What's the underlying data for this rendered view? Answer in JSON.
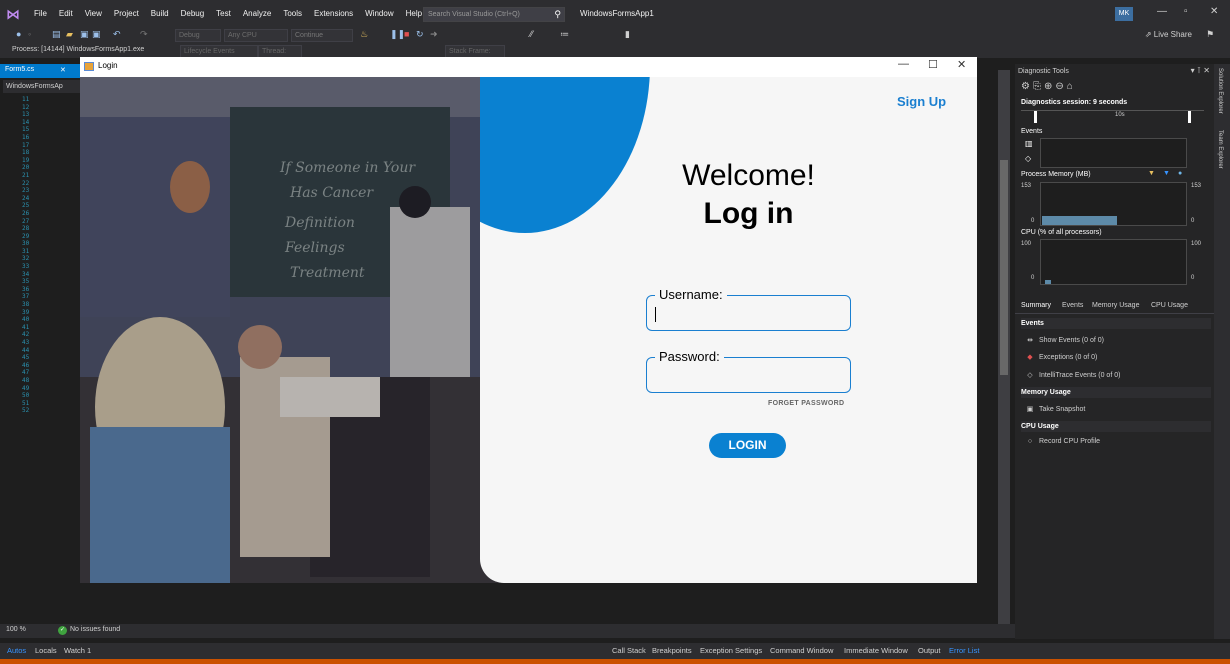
{
  "vs": {
    "menu": [
      "File",
      "Edit",
      "View",
      "Project",
      "Build",
      "Debug",
      "Test",
      "Analyze",
      "Tools",
      "Extensions",
      "Window",
      "Help"
    ],
    "search_placeholder": "Search Visual Studio (Ctrl+Q)",
    "solution_name": "WindowsFormsApp1",
    "user_initials": "MK",
    "live_share": "Live Share",
    "toolbar": {
      "config": "Debug",
      "platform": "Any CPU",
      "continue": "Continue",
      "lifecycle": "Lifecycle Events",
      "thread": "Thread:",
      "stack_frame": "Stack Frame:"
    },
    "process_label": "Process: [14144] WindowsFormsApp1.exe",
    "editor": {
      "tab_label": "Form5.cs",
      "nav_combo": "WindowsFormsAp",
      "line_numbers": [
        "11",
        "12",
        "13",
        "14",
        "15",
        "16",
        "17",
        "18",
        "19",
        "20",
        "21",
        "22",
        "23",
        "24",
        "25",
        "26",
        "27",
        "28",
        "29",
        "30",
        "31",
        "32",
        "33",
        "34",
        "35",
        "36",
        "37",
        "38",
        "39",
        "40",
        "41",
        "42",
        "43",
        "44",
        "45",
        "46",
        "47",
        "48",
        "49",
        "50",
        "51",
        "52"
      ],
      "zoom": "100 %",
      "issues": "No issues found"
    },
    "bottom_tabs": [
      "Autos",
      "Locals",
      "Watch 1",
      "Call Stack",
      "Breakpoints",
      "Exception Settings",
      "Command Window",
      "Immediate Window",
      "Output",
      "Error List"
    ],
    "side_tabs": [
      "Solution Explorer",
      "Team Explorer"
    ]
  },
  "diagnostics": {
    "title": "Diagnostic Tools",
    "session": "Diagnostics session: 9 seconds",
    "timeline_label": "10s",
    "events_label": "Events",
    "memory_label": "Process Memory (MB)",
    "memory_max": "153",
    "memory_min": "0",
    "memory_level": 0.25,
    "cpu_label": "CPU (% of all processors)",
    "cpu_max": "100",
    "cpu_min": "0",
    "tabs": [
      "Summary",
      "Events",
      "Memory Usage",
      "CPU Usage"
    ],
    "sections": {
      "events": "Events",
      "show_events": "Show Events (0 of 0)",
      "exceptions": "Exceptions (0 of 0)",
      "intellitrace": "IntelliTrace Events (0 of 0)",
      "memory": "Memory Usage",
      "snapshot": "Take Snapshot",
      "cpu": "CPU Usage",
      "record_cpu": "Record CPU Profile"
    },
    "colors": {
      "graph_fill": "#5d8aa8"
    }
  },
  "login": {
    "window_title": "Login",
    "sign_up": "Sign Up",
    "welcome": "Welcome!",
    "heading": "Log in",
    "username_label": "Username:",
    "password_label": "Password:",
    "forgot": "FORGET PASSWORD",
    "login_button": "LOGIN",
    "colors": {
      "accent": "#0a81d1"
    }
  }
}
